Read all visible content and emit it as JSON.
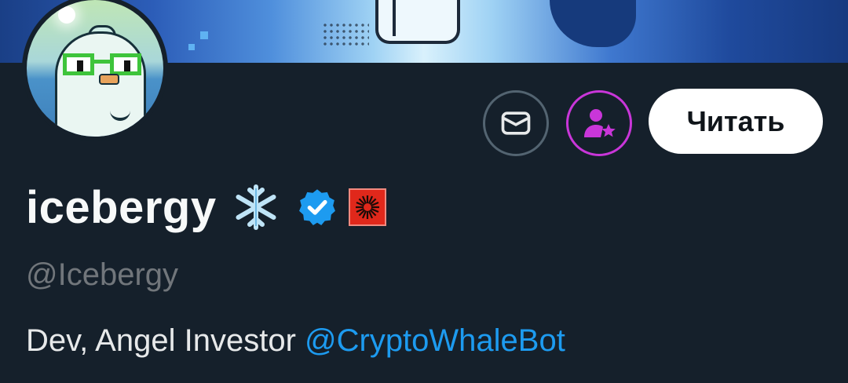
{
  "profile": {
    "display_name": "icebergy",
    "emoji": "❄️",
    "handle": "@Icebergy",
    "bio_text": "Dev, Angel Investor ",
    "bio_mention": "@CryptoWhaleBot"
  },
  "actions": {
    "follow_label": "Читать",
    "message_icon": "envelope-icon",
    "subscribe_icon": "person-star-icon"
  },
  "colors": {
    "background": "#15202b",
    "accent_link": "#1d9bf0",
    "verified": "#1d9bf0",
    "subscribe": "#c936d9",
    "org_badge": "#e0281b"
  }
}
